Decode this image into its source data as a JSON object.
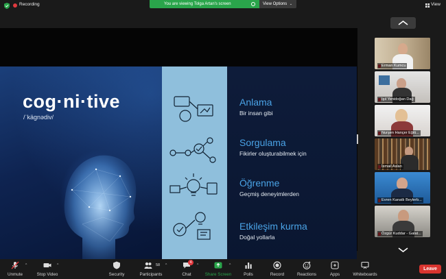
{
  "top_bar": {
    "recording_label": "Recording",
    "viewing_banner": "You are viewing Tolga Artan's screen",
    "view_options_label": "View Options",
    "view_label": "View"
  },
  "slide": {
    "word": "cog·ni·tive",
    "pronunciation": "/ˈkägnədiv/",
    "items": [
      {
        "title": "Anlama",
        "subtitle": "Bir insan gibi"
      },
      {
        "title": "Sorgulama",
        "subtitle": "Fikirler oluşturabilmek için"
      },
      {
        "title": "Öğrenme",
        "subtitle": "Geçmiş deneyimlerden"
      },
      {
        "title": "Etkileşim kurma",
        "subtitle": "Doğal yollarla"
      }
    ]
  },
  "participants": [
    {
      "name": "Erman Kumcu"
    },
    {
      "name": "Işıl Yenidoğan Dağ"
    },
    {
      "name": "Nurşen Hançer Eğiti..."
    },
    {
      "name": "İsmail Aslan"
    },
    {
      "name": "Evren Kanatlı Beylerb..."
    },
    {
      "name": "Özgür Kuddar - Galat..."
    }
  ],
  "toolbar": {
    "unmute": "Unmute",
    "stop_video": "Stop Video",
    "security": "Security",
    "participants": "Participants",
    "participants_count": "58",
    "chat": "Chat",
    "chat_badge": "4",
    "share_screen": "Share Screen",
    "polls": "Polls",
    "record": "Record",
    "reactions": "Reactions",
    "apps": "Apps",
    "whiteboards": "Whiteboards",
    "leave": "Leave"
  },
  "colors": {
    "accent_green": "#2aa54b",
    "leave_red": "#d9342f",
    "slide_accent_blue": "#4aa3e6"
  }
}
